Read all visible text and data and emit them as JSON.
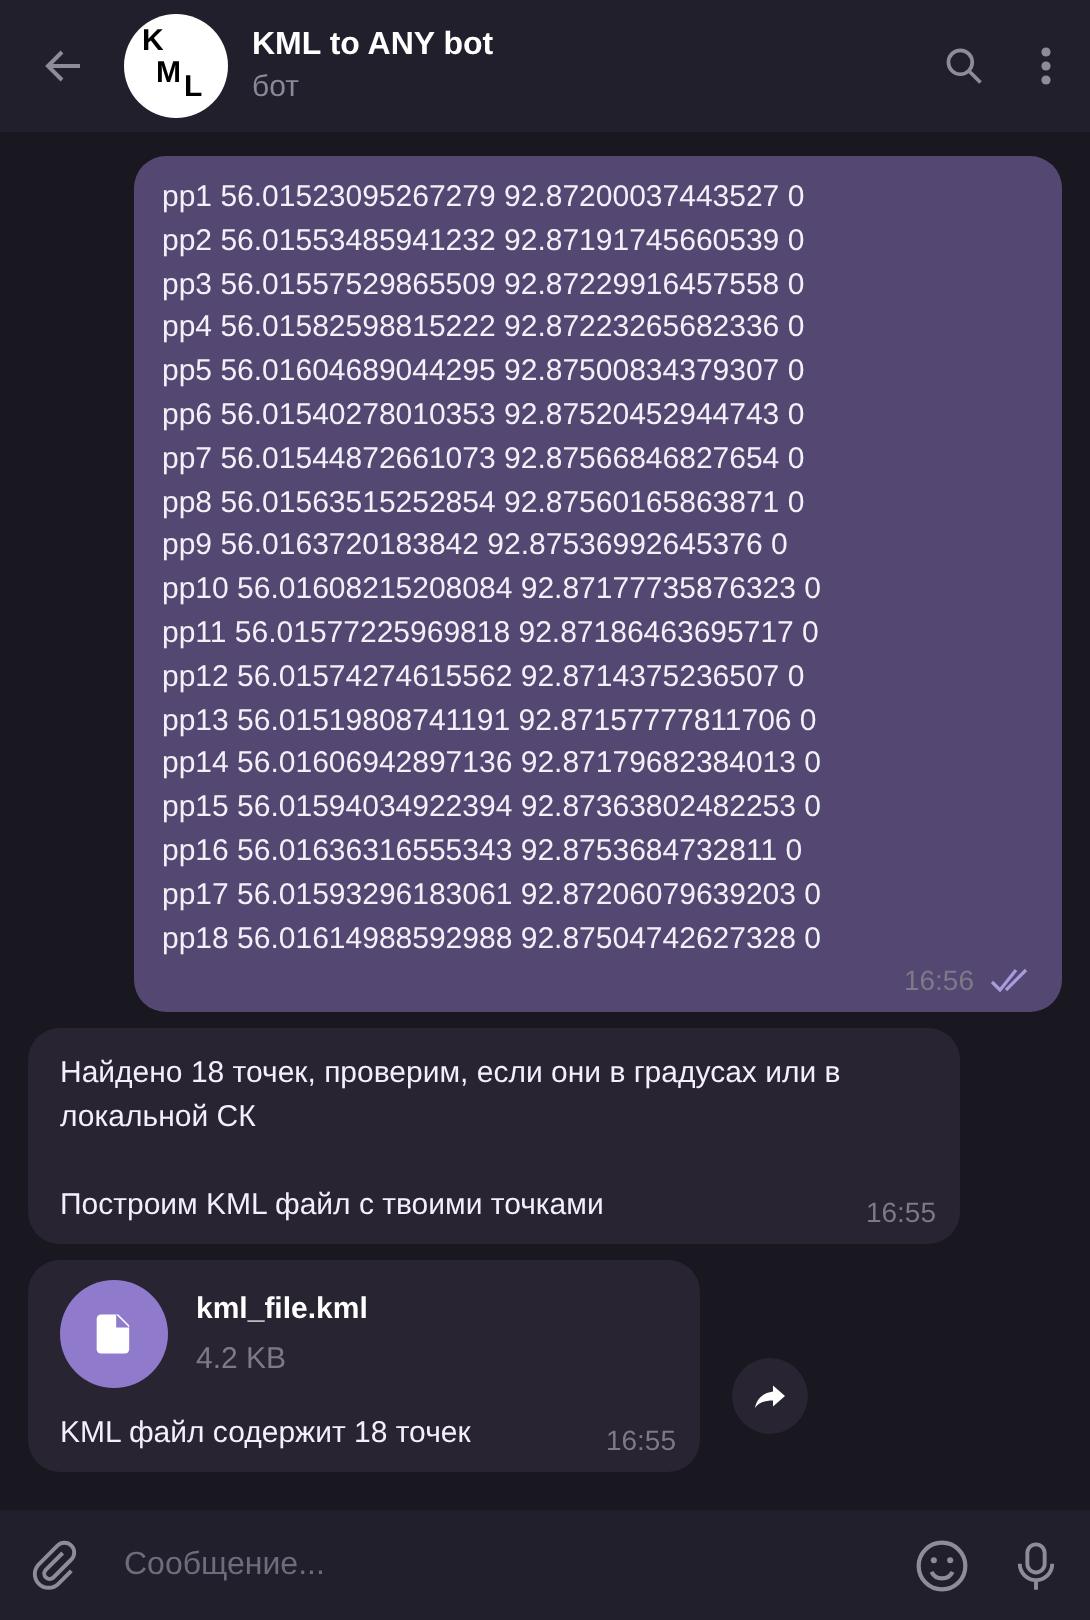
{
  "header": {
    "avatar_letters": [
      "K",
      "M",
      "L"
    ],
    "title": "KML to ANY bot",
    "subtitle": "бот"
  },
  "messages": [
    {
      "kind": "outgoing",
      "lines": [
        "pp1 56.01523095267279 92.87200037443527 0",
        "pp2 56.01553485941232 92.87191745660539 0",
        "pp3 56.01557529865509 92.87229916457558 0",
        "pp4 56.01582598815222 92.87223265682336 0",
        "pp5 56.01604689044295 92.87500834379307 0",
        "pp6 56.01540278010353 92.87520452944743 0",
        "pp7 56.01544872661073 92.87566846827654 0",
        "pp8 56.01563515252854 92.87560165863871 0",
        "pp9 56.0163720183842 92.87536992645376 0",
        "pp10 56.01608215208084 92.87177735876323 0",
        "pp11 56.01577225969818 92.87186463695717 0",
        "pp12 56.01574274615562 92.8714375236507 0",
        "pp13 56.01519808741191 92.87157777811706 0",
        "pp14 56.01606942897136 92.87179682384013 0",
        "pp15 56.01594034922394 92.87363802482253 0",
        "pp16 56.01636316555343 92.8753684732811 0",
        "pp17 56.01593296183061 92.87206079639203 0",
        "pp18 56.01614988592988 92.87504742627328 0"
      ],
      "time": "16:56",
      "read": true
    },
    {
      "kind": "incoming",
      "paragraphs": [
        "Найдено 18 точек, проверим, если они в градусах или в локальной СК",
        "Построим KML файл с твоими точками"
      ],
      "time": "16:55"
    },
    {
      "kind": "file",
      "file_name": "kml_file.kml",
      "file_size": "4.2 KB",
      "caption": "KML файл содержит 18 точек",
      "time": "16:55"
    }
  ],
  "composer": {
    "placeholder": "Сообщение..."
  }
}
